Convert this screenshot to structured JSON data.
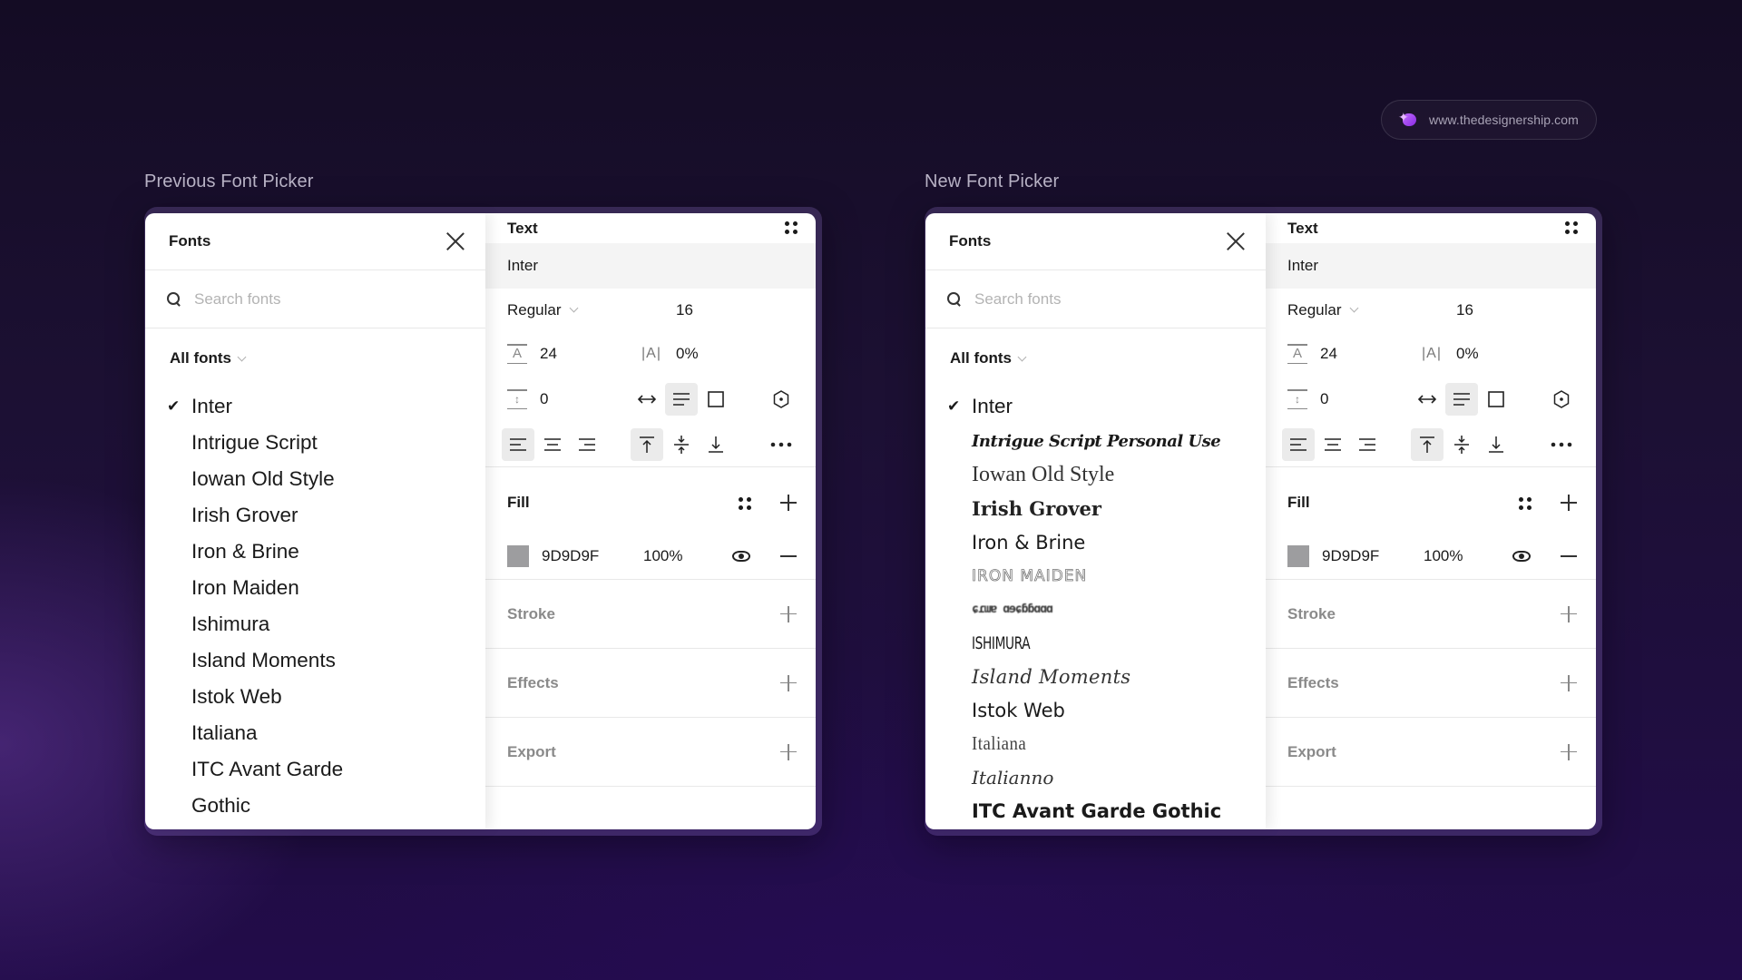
{
  "badge": {
    "logo_icon": "designership-logo-icon",
    "text": "www.thedesignership.com"
  },
  "comparisons": [
    {
      "id": "previous",
      "label": "Previous Font Picker",
      "fonts_panel": {
        "title": "Fonts",
        "close_icon": "close-icon",
        "search": {
          "placeholder": "Search fonts",
          "value": ""
        },
        "filter": {
          "label": "All fonts",
          "icon": "chevron-down-icon"
        },
        "selected": "Inter",
        "items": [
          {
            "label": "Inter",
            "checked": true,
            "preview_style": "default"
          },
          {
            "label": "Intrigue Script",
            "checked": false,
            "preview_style": "default"
          },
          {
            "label": "Iowan Old Style",
            "checked": false,
            "preview_style": "default"
          },
          {
            "label": "Irish Grover",
            "checked": false,
            "preview_style": "default"
          },
          {
            "label": "Iron & Brine",
            "checked": false,
            "preview_style": "default"
          },
          {
            "label": "Iron Maiden",
            "checked": false,
            "preview_style": "default"
          },
          {
            "label": "Ishimura",
            "checked": false,
            "preview_style": "default"
          },
          {
            "label": "Island Moments",
            "checked": false,
            "preview_style": "default"
          },
          {
            "label": "Istok Web",
            "checked": false,
            "preview_style": "default"
          },
          {
            "label": "Italiana",
            "checked": false,
            "preview_style": "default"
          },
          {
            "label": "ITC Avant Garde",
            "checked": false,
            "preview_style": "default"
          },
          {
            "label": "Gothic",
            "checked": false,
            "preview_style": "default"
          }
        ]
      }
    },
    {
      "id": "new",
      "label": "New Font Picker",
      "fonts_panel": {
        "title": "Fonts",
        "close_icon": "close-icon",
        "search": {
          "placeholder": "Search fonts",
          "value": ""
        },
        "filter": {
          "label": "All fonts",
          "icon": "chevron-down-icon"
        },
        "selected": "Inter",
        "items": [
          {
            "label": "Inter",
            "checked": true,
            "preview_style": "default"
          },
          {
            "label": "Intrigue Script Personal Use",
            "checked": false,
            "preview_style": "script"
          },
          {
            "label": "Iowan Old Style",
            "checked": false,
            "preview_style": "iowan"
          },
          {
            "label": "Irish Grover",
            "checked": false,
            "preview_style": "irish"
          },
          {
            "label": "Iron & Brine",
            "checked": false,
            "preview_style": "iron"
          },
          {
            "label": "Iron Maiden",
            "checked": false,
            "preview_style": "maiden"
          },
          {
            "label": "Ishimura (glyphs)",
            "checked": false,
            "preview_style": "ishimura-g"
          },
          {
            "label": "ISHIMURA",
            "checked": false,
            "preview_style": "ishimura"
          },
          {
            "label": "Island Moments",
            "checked": false,
            "preview_style": "island"
          },
          {
            "label": "Istok Web",
            "checked": false,
            "preview_style": "istok"
          },
          {
            "label": "Italiana",
            "checked": false,
            "preview_style": "italiana"
          },
          {
            "label": "Italianno",
            "checked": false,
            "preview_style": "italianno"
          },
          {
            "label": "ITC Avant Garde Gothic",
            "checked": false,
            "preview_style": "itc"
          }
        ]
      }
    }
  ],
  "text_panel": {
    "title": "Text",
    "grid_icon": "four-dots-icon",
    "font_family": "Inter",
    "font_style": "Regular",
    "font_size": "16",
    "line_height": "24",
    "letter_spacing": "0%",
    "paragraph_spacing": "0",
    "resize_icons": [
      "auto-width-icon",
      "auto-height-icon",
      "fixed-size-icon"
    ],
    "resize_active": "auto-height-icon",
    "type_settings_icon": "type-settings-icon",
    "align_h": [
      "align-left-icon",
      "align-center-icon",
      "align-right-icon"
    ],
    "align_h_active": "align-left-icon",
    "align_v": [
      "align-top-icon",
      "align-middle-icon",
      "align-bottom-icon"
    ],
    "align_v_active": "align-top-icon",
    "more_icon": "more-icon",
    "fill": {
      "title": "Fill",
      "color_hex": "9D9D9F",
      "swatch_color": "#9D9D9F",
      "opacity": "100%",
      "visible": true
    },
    "sections": [
      "Stroke",
      "Effects",
      "Export"
    ]
  }
}
